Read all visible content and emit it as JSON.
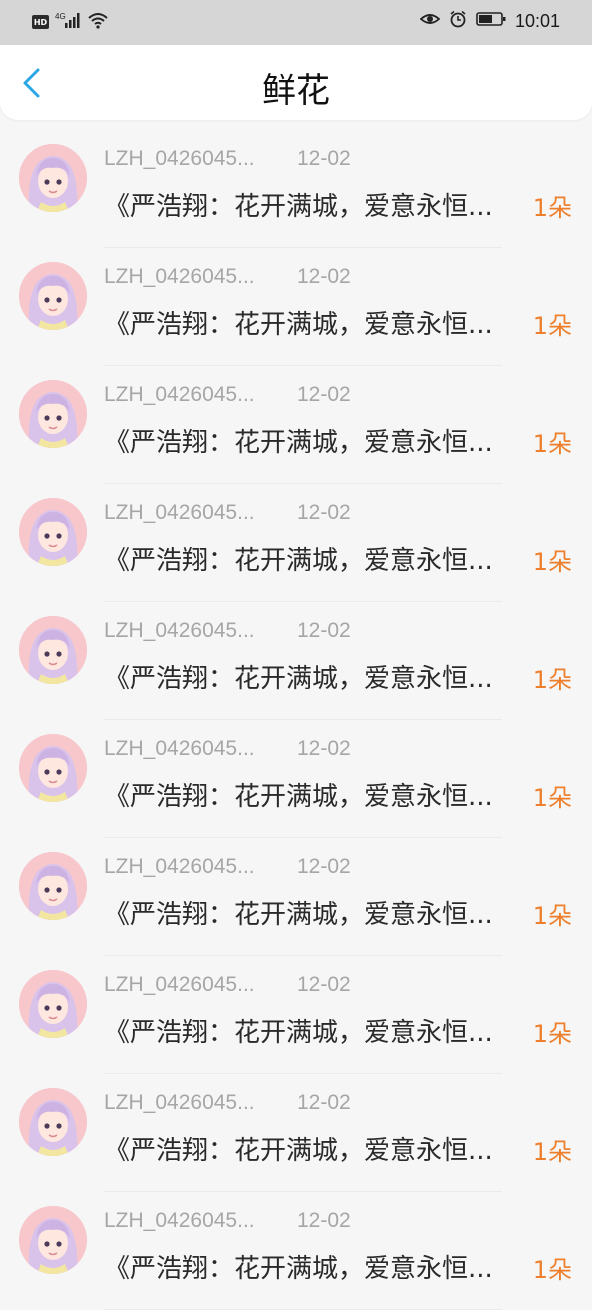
{
  "status_bar": {
    "network": "4G",
    "badge": "HD",
    "time": "10:01"
  },
  "header": {
    "title": "鲜花",
    "back_icon": "chevron-left-icon"
  },
  "colors": {
    "accent": "#2aa7e6",
    "count": "#ee7f2d",
    "meta_text": "#a6a6a6"
  },
  "items": [
    {
      "name": "LZH_0426045...",
      "date": "12-02",
      "message": "《严浩翔：花开满城，爱意永恒...",
      "count": "1朵"
    },
    {
      "name": "LZH_0426045...",
      "date": "12-02",
      "message": "《严浩翔：花开满城，爱意永恒...",
      "count": "1朵"
    },
    {
      "name": "LZH_0426045...",
      "date": "12-02",
      "message": "《严浩翔：花开满城，爱意永恒...",
      "count": "1朵"
    },
    {
      "name": "LZH_0426045...",
      "date": "12-02",
      "message": "《严浩翔：花开满城，爱意永恒...",
      "count": "1朵"
    },
    {
      "name": "LZH_0426045...",
      "date": "12-02",
      "message": "《严浩翔：花开满城，爱意永恒...",
      "count": "1朵"
    },
    {
      "name": "LZH_0426045...",
      "date": "12-02",
      "message": "《严浩翔：花开满城，爱意永恒...",
      "count": "1朵"
    },
    {
      "name": "LZH_0426045...",
      "date": "12-02",
      "message": "《严浩翔：花开满城，爱意永恒...",
      "count": "1朵"
    },
    {
      "name": "LZH_0426045...",
      "date": "12-02",
      "message": "《严浩翔：花开满城，爱意永恒...",
      "count": "1朵"
    },
    {
      "name": "LZH_0426045...",
      "date": "12-02",
      "message": "《严浩翔：花开满城，爱意永恒...",
      "count": "1朵"
    },
    {
      "name": "LZH_0426045...",
      "date": "12-02",
      "message": "《严浩翔：花开满城，爱意永恒...",
      "count": "1朵"
    }
  ]
}
